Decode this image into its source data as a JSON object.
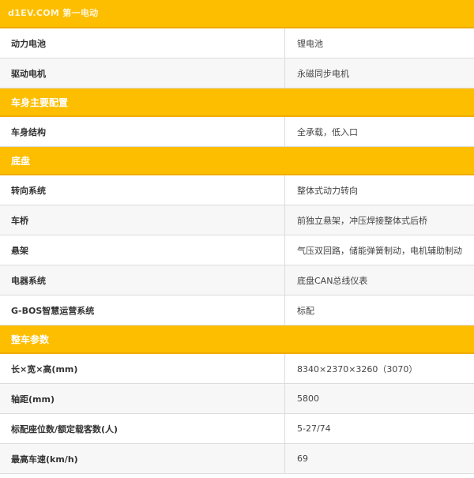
{
  "watermark": "d1EV.COM 第一电动",
  "sections": [
    {
      "title": "",
      "rows": [
        {
          "label": "动力电池",
          "value": "锂电池"
        },
        {
          "label": "驱动电机",
          "value": "永磁同步电机"
        }
      ]
    },
    {
      "title": "车身主要配置",
      "rows": [
        {
          "label": "车身结构",
          "value": "全承载，低入口"
        }
      ]
    },
    {
      "title": "底盘",
      "rows": [
        {
          "label": "转向系统",
          "value": "整体式动力转向"
        },
        {
          "label": "车桥",
          "value": "前独立悬架，冲压焊接整体式后桥"
        },
        {
          "label": "悬架",
          "value": "气压双回路，储能弹簧制动，电机辅助制动"
        },
        {
          "label": "电器系统",
          "value": "底盘CAN总线仪表"
        },
        {
          "label": "G-BOS智慧运营系统",
          "value": "标配"
        }
      ]
    },
    {
      "title": "整车参数",
      "rows": [
        {
          "label": "长×宽×高(mm)",
          "value": "8340×2370×3260（3070）"
        },
        {
          "label": "轴距(mm)",
          "value": "5800"
        },
        {
          "label": "标配座位数/额定载客数(人)",
          "value": "5-27/74"
        },
        {
          "label": "最高车速(km/h)",
          "value": "69"
        }
      ]
    }
  ]
}
